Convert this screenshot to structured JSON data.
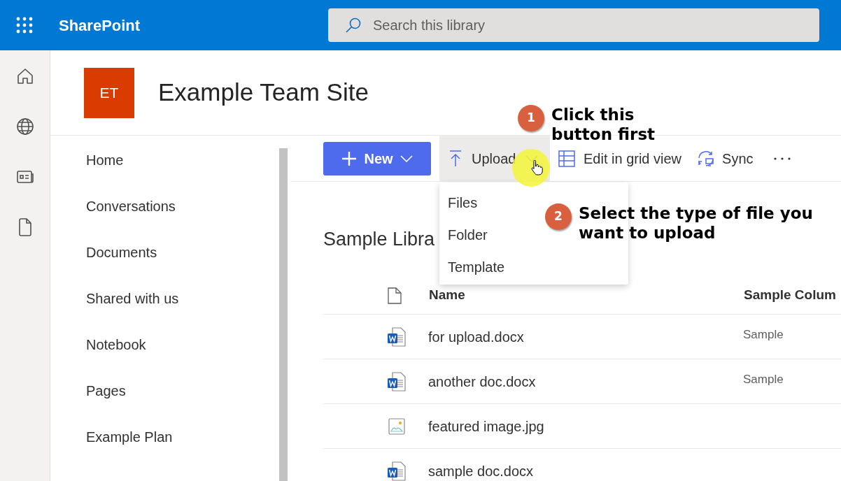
{
  "app": {
    "name": "SharePoint"
  },
  "search": {
    "placeholder": "Search this library"
  },
  "site": {
    "logo": "ET",
    "title": "Example Team Site"
  },
  "nav": {
    "items": [
      "Home",
      "Conversations",
      "Documents",
      "Shared with us",
      "Notebook",
      "Pages",
      "Example Plan"
    ]
  },
  "toolbar": {
    "buttons": [
      {
        "kind": "new",
        "label": "New",
        "expanded": false
      },
      {
        "kind": "upload",
        "label": "Upload",
        "expanded": true
      },
      {
        "kind": "grid",
        "label": "Edit in grid view",
        "expanded": false
      },
      {
        "kind": "sync",
        "label": "Sync",
        "expanded": false
      },
      {
        "kind": "more",
        "expanded": false
      }
    ]
  },
  "upload_menu": {
    "items": [
      "Files",
      "Folder",
      "Template"
    ]
  },
  "library": {
    "title": "Sample Libra",
    "columns": [
      "Name",
      "Sample Colum"
    ],
    "rows": [
      {
        "kind": "word",
        "name": "for upload.docx",
        "sample_column": "Sample"
      },
      {
        "kind": "word",
        "name": "another doc.docx",
        "sample_column": "Sample"
      },
      {
        "kind": "image",
        "name": "featured image.jpg"
      },
      {
        "kind": "word",
        "name": "sample doc.docx"
      }
    ]
  },
  "annotations": [
    {
      "number": "1",
      "text": "Click this button first"
    },
    {
      "number": "2",
      "text": "Select the type of file you want to upload"
    }
  ]
}
